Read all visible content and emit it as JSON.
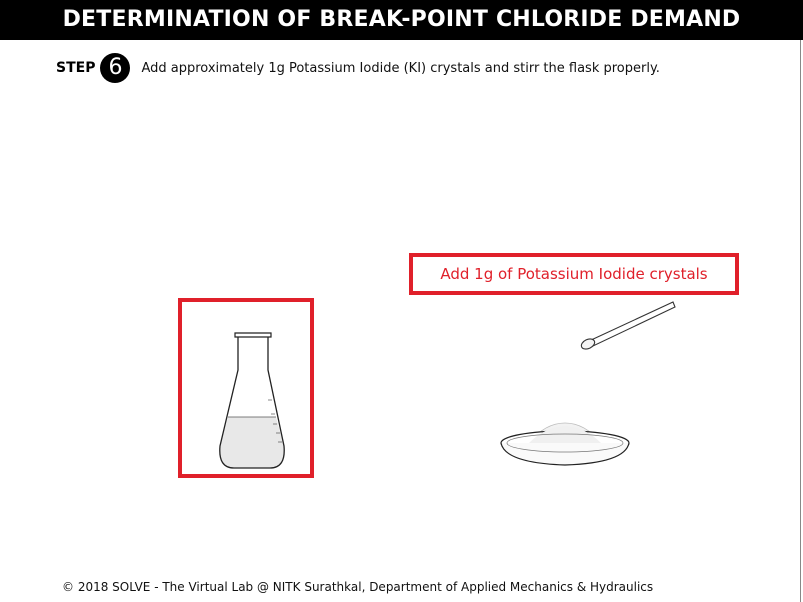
{
  "header": {
    "title": "DETERMINATION OF BREAK-POINT CHLORIDE DEMAND"
  },
  "step": {
    "label": "STEP",
    "number": "6",
    "instruction": "Add approximately 1g Potassium Iodide (KI) crystals and stirr the flask properly."
  },
  "action": {
    "label": "Add 1g of Potassium Iodide crystals"
  },
  "icons": {
    "flask": "conical-flask-icon",
    "spatula": "spatula-icon",
    "dish": "petri-dish-icon"
  },
  "colors": {
    "highlight": "#e0202a",
    "header_bg": "#000000"
  },
  "footer": {
    "text": "© 2018 SOLVE - The Virtual Lab @ NITK Surathkal, Department of Applied Mechanics & Hydraulics"
  }
}
